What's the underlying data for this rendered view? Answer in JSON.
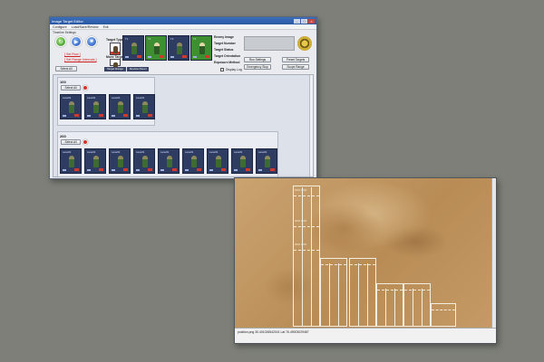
{
  "window1": {
    "title": "Image Target Editor",
    "menu": [
      "Configure",
      "Load/Save/Review",
      "Exit"
    ],
    "group_caption": "Timeline Settings",
    "links": [
      "[ Set Row ]",
      "[ Set Range Intervals ]"
    ],
    "select_all": "Select All",
    "labels": {
      "target_type": "Target Type:",
      "move_target": "Move Target",
      "enemy_image": "Enemy Image",
      "target_number": "Target Number",
      "target_status": "Target Status",
      "target_orientation": "Target Orientation",
      "exposure_method": "Exposure Method",
      "display_log": "Display Log"
    },
    "buttons": {
      "run_settings": "Run Settings",
      "emergency_stop": "Emergency Stop",
      "preset_targets": "Preset Targets",
      "scope_range": "Scope Range"
    },
    "tabs": [
      "Target Range",
      "Review Panel"
    ],
    "groups": [
      {
        "title": "100",
        "select_all": "Select All",
        "card_label": "Lane#1",
        "count": 4
      },
      {
        "title": "200",
        "select_all": "Select All",
        "card_label": "Lane#1",
        "count": 9
      }
    ],
    "top_cards": [
      {
        "label": "T1",
        "style": "dark"
      },
      {
        "label": "T2",
        "style": "green"
      },
      {
        "label": "T3",
        "style": "dark"
      },
      {
        "label": "T4",
        "style": "green"
      }
    ]
  },
  "window2": {
    "status_text": "position.png  30.401026542041  Lat  76.49003029487",
    "range_marks": [
      "0000 0000",
      "0000 0000",
      "0000 0000"
    ]
  },
  "colors": {
    "background": "#7d7f78",
    "title_blue": "#3c6db8",
    "card_navy": "#2f3c62",
    "desert": "#c49a63",
    "link_red": "#d01c1c"
  }
}
